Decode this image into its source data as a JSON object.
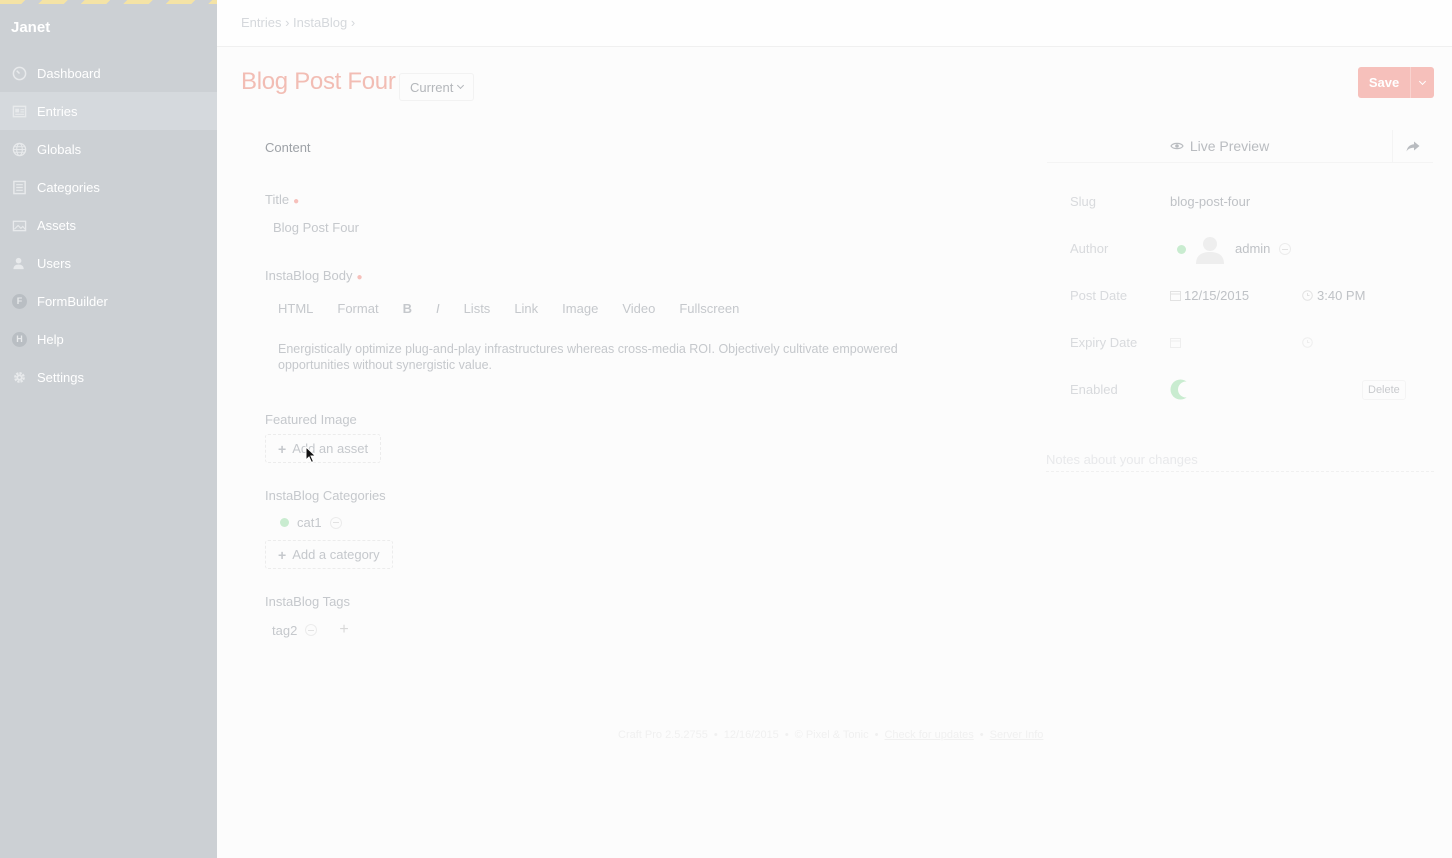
{
  "sidebar": {
    "site_name": "Janet",
    "items": [
      {
        "label": "Dashboard",
        "icon": "dashboard-icon"
      },
      {
        "label": "Entries",
        "icon": "entries-icon",
        "active": true
      },
      {
        "label": "Globals",
        "icon": "globe-icon"
      },
      {
        "label": "Categories",
        "icon": "categories-icon"
      },
      {
        "label": "Assets",
        "icon": "assets-icon"
      },
      {
        "label": "Users",
        "icon": "users-icon"
      },
      {
        "label": "FormBuilder",
        "icon": "formbuilder-icon",
        "glyph": "F"
      },
      {
        "label": "Help",
        "icon": "help-icon",
        "glyph": "H"
      },
      {
        "label": "Settings",
        "icon": "gear-icon"
      }
    ]
  },
  "breadcrumb": {
    "items": [
      "Entries",
      "InstaBlog"
    ]
  },
  "header": {
    "title": "Blog Post Four",
    "revision": "Current",
    "save_label": "Save"
  },
  "content": {
    "tab_label": "Content",
    "title_label": "Title",
    "title_value": "Blog Post Four",
    "body_label": "InstaBlog Body",
    "toolbar": [
      "HTML",
      "Format",
      "B",
      "I",
      "Lists",
      "Link",
      "Image",
      "Video",
      "Fullscreen"
    ],
    "body_text": "Energistically optimize plug-and-play infrastructures whereas cross-media ROI. Objectively cultivate empowered opportunities without synergistic value.",
    "image_label": "Featured Image",
    "add_asset_label": "Add an asset",
    "categories_label": "InstaBlog Categories",
    "category_item": "cat1",
    "add_category_label": "Add a category",
    "tags_label": "InstaBlog Tags",
    "tag_item": "tag2"
  },
  "meta": {
    "live_preview_label": "Live Preview",
    "slug_label": "Slug",
    "slug_value": "blog-post-four",
    "author_label": "Author",
    "author_value": "admin",
    "post_date_label": "Post Date",
    "post_date": "12/15/2015",
    "post_time": "3:40 PM",
    "expiry_date_label": "Expiry Date",
    "enabled_label": "Enabled",
    "delete_label": "Delete",
    "notes_placeholder": "Notes about your changes"
  },
  "footer": {
    "version": "Craft Pro 2.5.2755",
    "date": "12/16/2015",
    "copyright": "© Pixel & Tonic",
    "updates_link": "Check for updates",
    "server_link": "Server Info"
  },
  "colors": {
    "sidebar_bg": "#ccd0d4",
    "accent": "#f6c0bb",
    "enabled_green": "#c9ecd0"
  }
}
